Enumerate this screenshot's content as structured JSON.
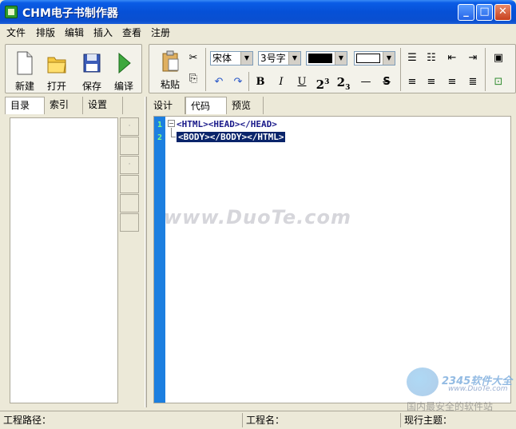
{
  "window": {
    "title": "CHM电子书制作器"
  },
  "menu": [
    "文件",
    "排版",
    "编辑",
    "插入",
    "查看",
    "注册"
  ],
  "file_toolbar": {
    "new": "新建",
    "open": "打开",
    "save": "保存",
    "compile": "编译"
  },
  "edit_toolbar": {
    "paste": "粘贴",
    "font": "宋体",
    "size": "3号字",
    "bold": "B",
    "italic": "I",
    "underline": "U",
    "superscript_base": "2",
    "superscript_exp": "3",
    "subscript_base": "2",
    "subscript_exp": "3",
    "hr": "—",
    "strike": "S"
  },
  "left_tabs": [
    "目录",
    "索引",
    "设置"
  ],
  "right_tabs": [
    "设计",
    "代码",
    "预览"
  ],
  "editor": {
    "lines": [
      {
        "num": "1",
        "code": "<HTML><HEAD></HEAD>"
      },
      {
        "num": "2",
        "code": "<BODY></BODY></HTML>"
      }
    ]
  },
  "watermark": "www.DuoTe.com",
  "logo_watermark": {
    "brand": "2345软件大全",
    "url": "www.DuoTe.com",
    "slogan": "国内最安全的软件站"
  },
  "status": {
    "path": "工程路径：",
    "name": "工程名：",
    "theme": "现行主题："
  }
}
